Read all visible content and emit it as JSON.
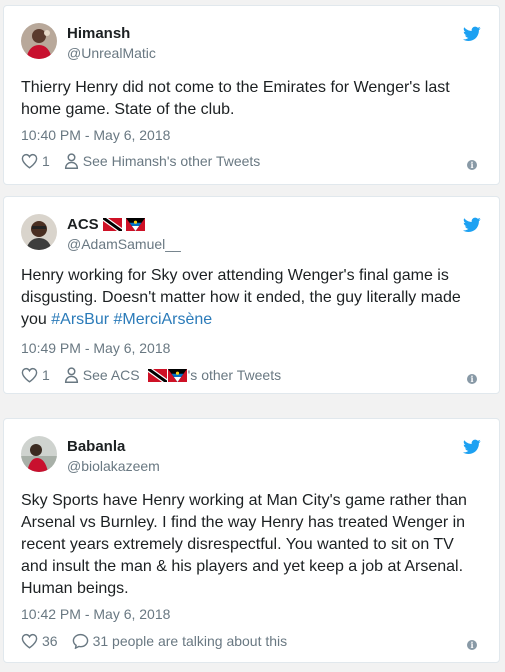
{
  "tweets": [
    {
      "display_name": "Himansh",
      "handle": "@UnrealMatic",
      "text": "Thierry Henry did not come to the Emirates for Wenger's last home game. State of the club.",
      "timestamp": "10:40 PM - May 6, 2018",
      "likes": "1",
      "secondary_action": "See Himansh's other Tweets"
    },
    {
      "display_name": "ACS",
      "handle": "@AdamSamuel__",
      "text_before_tags": "Henry working for Sky over attending Wenger's final game is disgusting. Doesn't matter how it ended, the guy literally made you ",
      "hashtag_1": "#ArsBur",
      "hashtag_2": "#MerciArsène",
      "timestamp": "10:49 PM - May 6, 2018",
      "likes": "1",
      "secondary_prefix": "See ACS",
      "secondary_suffix": "'s other Tweets"
    },
    {
      "display_name": "Babanla",
      "handle": "@biolakazeem",
      "text": "Sky Sports have Henry working at Man City's game rather than Arsenal vs Burnley. I find the way Henry has treated Wenger in recent years extremely disrespectful. You wanted to sit on TV and insult the man & his players and yet keep a job at Arsenal. Human beings.",
      "timestamp": "10:42 PM - May 6, 2018",
      "likes": "36",
      "secondary_action": "31 people are talking about this"
    }
  ],
  "colors": {
    "twitter_blue": "#1da1f2",
    "hashtag": "#2b7bb9",
    "muted": "#697882",
    "border": "#e1e8ed"
  },
  "icons": [
    "twitter-bird-icon",
    "heart-icon",
    "person-icon",
    "comment-icon",
    "info-icon",
    "trinidad-flag-icon",
    "antigua-flag-icon"
  ]
}
